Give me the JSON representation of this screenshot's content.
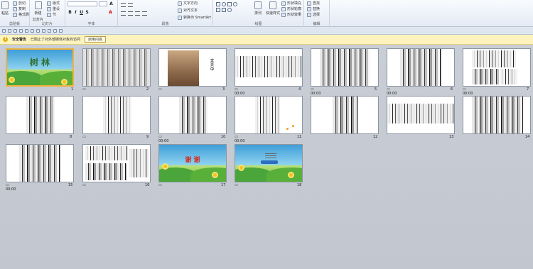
{
  "ribbon": {
    "clipboard": {
      "paste": "粘贴",
      "cut": "剪切",
      "copy": "复制",
      "format_painter": "格式刷",
      "label": "剪贴板"
    },
    "slides": {
      "new_slide": "新建",
      "new_slide_sub": "幻灯片",
      "layout": "版式",
      "reset": "重设",
      "section": "节",
      "label": "幻灯片"
    },
    "font": {
      "label": "字体",
      "bold": "B",
      "italic": "I",
      "underline": "U",
      "strike": "S",
      "font_name": "",
      "font_size": ""
    },
    "paragraph": {
      "label": "段落",
      "text_direction": "文字方向",
      "align_text": "对齐文本",
      "smartart": "转换为 SmartArt"
    },
    "drawing": {
      "label": "绘图",
      "arrange": "排列",
      "quick_styles": "快速样式",
      "shape_fill": "形状填充",
      "shape_outline": "形状轮廓",
      "shape_effects": "形状效果"
    },
    "editing": {
      "label": "编辑",
      "find": "查找",
      "replace": "替换",
      "select": "选择"
    }
  },
  "security_bar": {
    "title": "安全警告",
    "message": "已阻止了对外部媒体对象的访问",
    "button": "启用内容"
  },
  "slides": [
    {
      "number": "1",
      "time": "",
      "title": "树 林",
      "selected": true
    },
    {
      "number": "2",
      "time": "",
      "title": ""
    },
    {
      "number": "3",
      "time": "",
      "vertical_text": "文贝中"
    },
    {
      "number": "4",
      "time": "00:00",
      "title": ""
    },
    {
      "number": "5",
      "time": "00:00",
      "title": ""
    },
    {
      "number": "6",
      "time": "00:00",
      "title": ""
    },
    {
      "number": "7",
      "time": "00:00",
      "title": ""
    },
    {
      "number": "8",
      "time": "",
      "title": ""
    },
    {
      "number": "9",
      "time": "",
      "title": ""
    },
    {
      "number": "10",
      "time": "00:00",
      "title": ""
    },
    {
      "number": "11",
      "time": "00:00",
      "title": ""
    },
    {
      "number": "12",
      "time": "",
      "title": ""
    },
    {
      "number": "13",
      "time": "",
      "title": ""
    },
    {
      "number": "14",
      "time": "",
      "title": ""
    },
    {
      "number": "15",
      "time": "00:00",
      "title": ""
    },
    {
      "number": "16",
      "time": "",
      "title": ""
    },
    {
      "number": "17",
      "time": "",
      "title": "谢 谢"
    },
    {
      "number": "18",
      "time": "",
      "title": ""
    }
  ],
  "colors": {
    "selected_border": "#f0b23c",
    "security_bar": "#fcf3bf",
    "sorter_bg": "#c7ccd3"
  }
}
